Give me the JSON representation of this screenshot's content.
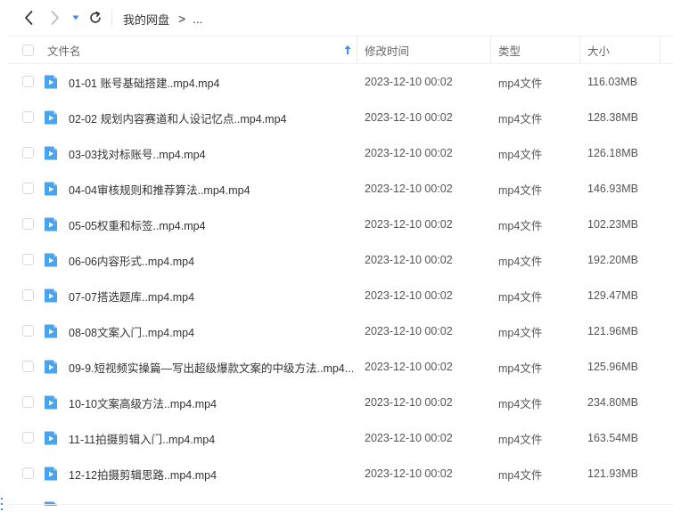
{
  "toolbar": {
    "back_icon": "chevron-left-icon",
    "forward_icon": "chevron-right-icon",
    "history_icon": "caret-down-icon",
    "refresh_icon": "refresh-icon",
    "breadcrumb_root": "我的网盘",
    "breadcrumb_separator": ">",
    "breadcrumb_more": "...",
    "accent_color": "#3a8ee6"
  },
  "header": {
    "name": "文件名",
    "modified": "修改时间",
    "type": "类型",
    "size": "大小"
  },
  "files": [
    {
      "name": "01-01 账号基础搭建..mp4.mp4",
      "date": "2023-12-10 00:02",
      "type": "mp4文件",
      "size": "116.03MB"
    },
    {
      "name": "02-02 规划内容赛道和人设记忆点..mp4.mp4",
      "date": "2023-12-10 00:02",
      "type": "mp4文件",
      "size": "128.38MB"
    },
    {
      "name": "03-03找对标账号..mp4.mp4",
      "date": "2023-12-10 00:02",
      "type": "mp4文件",
      "size": "126.18MB"
    },
    {
      "name": "04-04审核规则和推荐算法..mp4.mp4",
      "date": "2023-12-10 00:02",
      "type": "mp4文件",
      "size": "146.93MB"
    },
    {
      "name": "05-05权重和标签..mp4.mp4",
      "date": "2023-12-10 00:02",
      "type": "mp4文件",
      "size": "102.23MB"
    },
    {
      "name": "06-06内容形式..mp4.mp4",
      "date": "2023-12-10 00:02",
      "type": "mp4文件",
      "size": "192.20MB"
    },
    {
      "name": "07-07搭选题库..mp4.mp4",
      "date": "2023-12-10 00:02",
      "type": "mp4文件",
      "size": "129.47MB"
    },
    {
      "name": "08-08文案入门..mp4.mp4",
      "date": "2023-12-10 00:02",
      "type": "mp4文件",
      "size": "121.96MB"
    },
    {
      "name": "09-9.短视频实操篇—写出超级爆款文案的中级方法..mp4....",
      "date": "2023-12-10 00:02",
      "type": "mp4文件",
      "size": "125.96MB"
    },
    {
      "name": "10-10文案高级方法..mp4.mp4",
      "date": "2023-12-10 00:02",
      "type": "mp4文件",
      "size": "234.80MB"
    },
    {
      "name": "11-11拍摄剪辑入门..mp4.mp4",
      "date": "2023-12-10 00:02",
      "type": "mp4文件",
      "size": "163.54MB"
    },
    {
      "name": "12-12拍摄剪辑思路..mp4.mp4",
      "date": "2023-12-10 00:02",
      "type": "mp4文件",
      "size": "121.93MB"
    }
  ],
  "file_icon": "video-file-icon",
  "file_icon_color": "#4aa3f0"
}
